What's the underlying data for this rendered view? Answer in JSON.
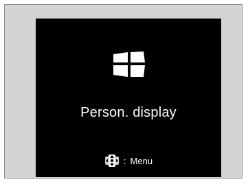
{
  "screen": {
    "title": "Person. display",
    "hint_separator": ":",
    "hint_label": "Menu",
    "icons": {
      "display": "personalized-display-icon",
      "control": "joystick-icon"
    },
    "colors": {
      "screen_background": "#000000",
      "text": "#ffffff",
      "frame_background": "#d4d4d4"
    }
  }
}
